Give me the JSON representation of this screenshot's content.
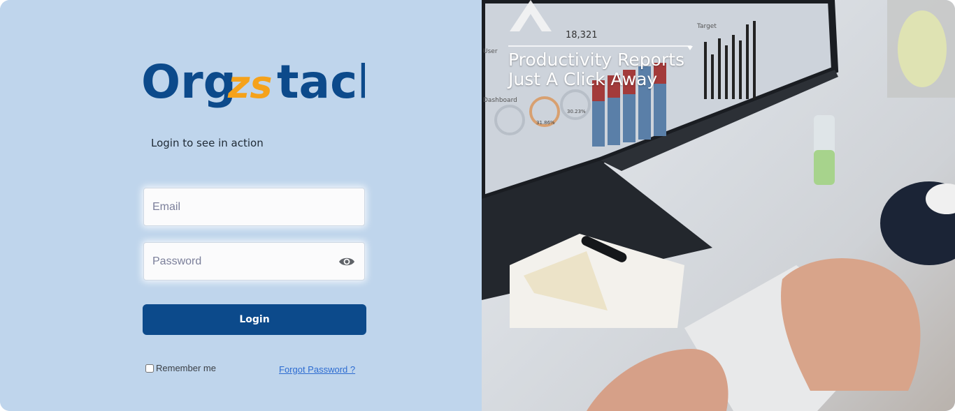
{
  "brand": {
    "name_part1": "Org",
    "name_part2": "zs",
    "name_part3": "tack",
    "primary_color": "#0c4a8b",
    "accent_color": "#f5a21b"
  },
  "login": {
    "tagline": "Login to see in action",
    "email_placeholder": "Email",
    "password_placeholder": "Password",
    "password_toggle_icon": "eye-icon",
    "login_button": "Login",
    "remember_label": "Remember me",
    "forgot_label": "Forgot Password ?"
  },
  "hero": {
    "line1": "Productivity Reports",
    "line2": "Just A Click Away",
    "screen_stat": "18,321",
    "screen_labels": [
      "User",
      "Dashboard",
      "Target"
    ],
    "screen_percents": [
      "31.86%",
      "30.23%"
    ]
  },
  "colors": {
    "left_background": "#bfd5ec",
    "button_background": "#0c4a8b",
    "link_color": "#2d6cd1"
  }
}
